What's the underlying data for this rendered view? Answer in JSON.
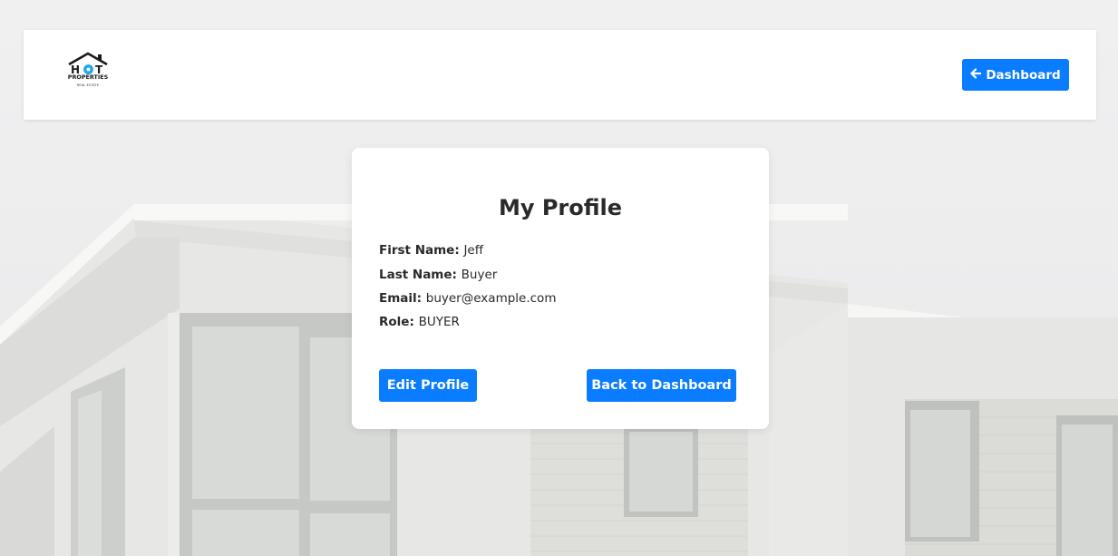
{
  "brand": {
    "logo_line1": "HOT",
    "logo_line2": "PROPERTIES",
    "logo_line3": "REAL ESTATE"
  },
  "header": {
    "dashboard_arrow": "🡐",
    "dashboard_label": "Dashboard"
  },
  "profile": {
    "title": "My Profile",
    "fields": [
      {
        "label": "First Name:",
        "value": "Jeff"
      },
      {
        "label": "Last Name:",
        "value": "Buyer"
      },
      {
        "label": "Email:",
        "value": "buyer@example.com"
      },
      {
        "label": "Role:",
        "value": "BUYER"
      }
    ],
    "edit_label": "Edit Profile",
    "back_label": "Back to Dashboard"
  },
  "colors": {
    "accent": "#0a7cff",
    "logo_blue": "#1ea6e8",
    "background": "#ececee"
  },
  "icons": {
    "logo": "house-logo-icon",
    "dashboard": "arrow-left-icon"
  }
}
